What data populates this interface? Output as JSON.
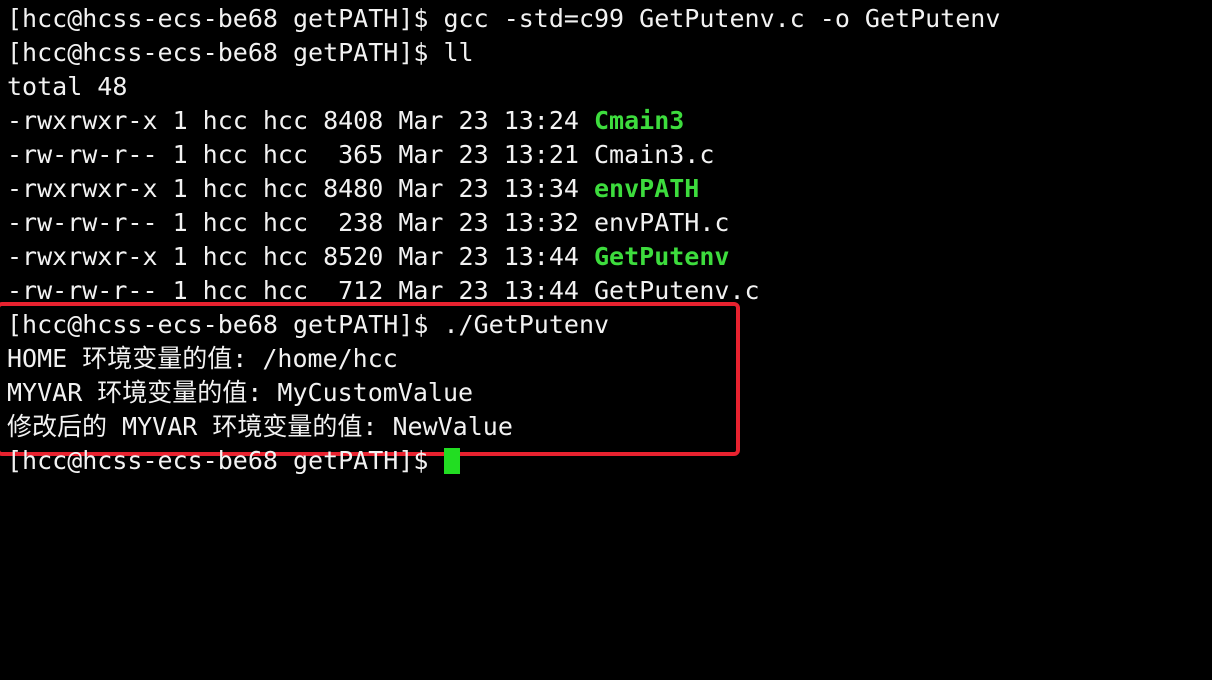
{
  "terminal": {
    "lines": [
      {
        "text": "[hcc@hcss-ecs-be68 getPATH]$ gcc -std=c99 GetPutenv.c -o GetPutenv"
      },
      {
        "text": "[hcc@hcss-ecs-be68 getPATH]$ ll"
      },
      {
        "text": "total 48"
      },
      {
        "prefix": "-rwxrwxr-x 1 hcc hcc 8408 Mar 23 13:24 ",
        "name": "Cmain3"
      },
      {
        "prefix": "-rw-rw-r-- 1 hcc hcc  365 Mar 23 13:21 ",
        "name": "Cmain3.c"
      },
      {
        "prefix": "-rwxrwxr-x 1 hcc hcc 8480 Mar 23 13:34 ",
        "name": "envPATH"
      },
      {
        "prefix": "-rw-rw-r-- 1 hcc hcc  238 Mar 23 13:32 ",
        "name": "envPATH.c"
      },
      {
        "prefix": "-rwxrwxr-x 1 hcc hcc 8520 Mar 23 13:44 ",
        "name": "GetPutenv"
      },
      {
        "prefix": "-rw-rw-r-- 1 hcc hcc  712 Mar 23 13:44 ",
        "name": "GetPutenv.c"
      },
      {
        "text": "[hcc@hcss-ecs-be68 getPATH]$ ./GetPutenv"
      },
      {
        "text": "HOME 环境变量的值: /home/hcc"
      },
      {
        "text": "MYVAR 环境变量的值: MyCustomValue"
      },
      {
        "text": "修改后的 MYVAR 环境变量的值: NewValue"
      },
      {
        "text": "[hcc@hcss-ecs-be68 getPATH]$ "
      }
    ]
  },
  "colors": {
    "background": "#000000",
    "foreground": "#f2f2f2",
    "executable": "#3ddc3d",
    "cursor": "#22dd22",
    "highlight_box": "#e8222f"
  }
}
